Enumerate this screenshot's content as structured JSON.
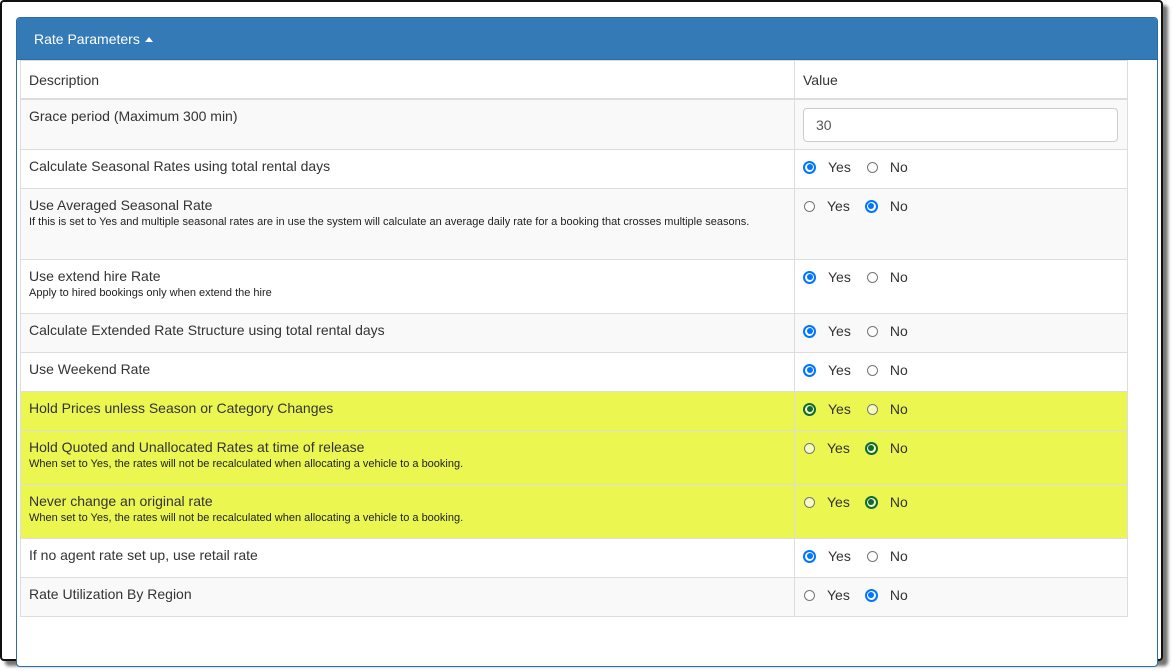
{
  "panel": {
    "title": "Rate Parameters"
  },
  "table": {
    "headers": {
      "description": "Description",
      "value": "Value"
    },
    "grace_period": {
      "label": "Grace period (Maximum 300 min)",
      "value": "30"
    },
    "rows": [
      {
        "label": "Calculate Seasonal Rates using total rental days",
        "note": "",
        "selected": "Yes",
        "highlighted": false
      },
      {
        "label": "Use Averaged Seasonal Rate",
        "note": "If this is set to Yes and multiple seasonal rates are in use the system will calculate an average daily rate for a booking that crosses multiple seasons.",
        "selected": "No",
        "highlighted": false
      },
      {
        "label": "Use extend hire Rate",
        "note": "Apply to hired bookings only when extend the hire",
        "selected": "Yes",
        "highlighted": false
      },
      {
        "label": "Calculate Extended Rate Structure using total rental days",
        "note": "",
        "selected": "Yes",
        "highlighted": false
      },
      {
        "label": "Use Weekend Rate",
        "note": "",
        "selected": "Yes",
        "highlighted": false
      },
      {
        "label": "Hold Prices unless Season or Category Changes",
        "note": "",
        "selected": "Yes",
        "highlighted": true
      },
      {
        "label": "Hold Quoted and Unallocated Rates at time of release",
        "note": "When set to Yes, the rates will not be recalculated when allocating a vehicle to a booking.",
        "selected": "No",
        "highlighted": true
      },
      {
        "label": "Never change an original rate",
        "note": "When set to Yes, the rates will not be recalculated when allocating a vehicle to a booking.",
        "selected": "No",
        "highlighted": true
      },
      {
        "label": "If no agent rate set up, use retail rate",
        "note": "",
        "selected": "Yes",
        "highlighted": false
      },
      {
        "label": "Rate Utilization By Region",
        "note": "",
        "selected": "No",
        "highlighted": false
      }
    ],
    "options": [
      "Yes",
      "No"
    ]
  },
  "colors": {
    "header_bg": "#337ab7",
    "highlight_bg": "#ecf651",
    "radio_checked": "#0075ff",
    "radio_checked_highlighted": "#0f6a35"
  }
}
